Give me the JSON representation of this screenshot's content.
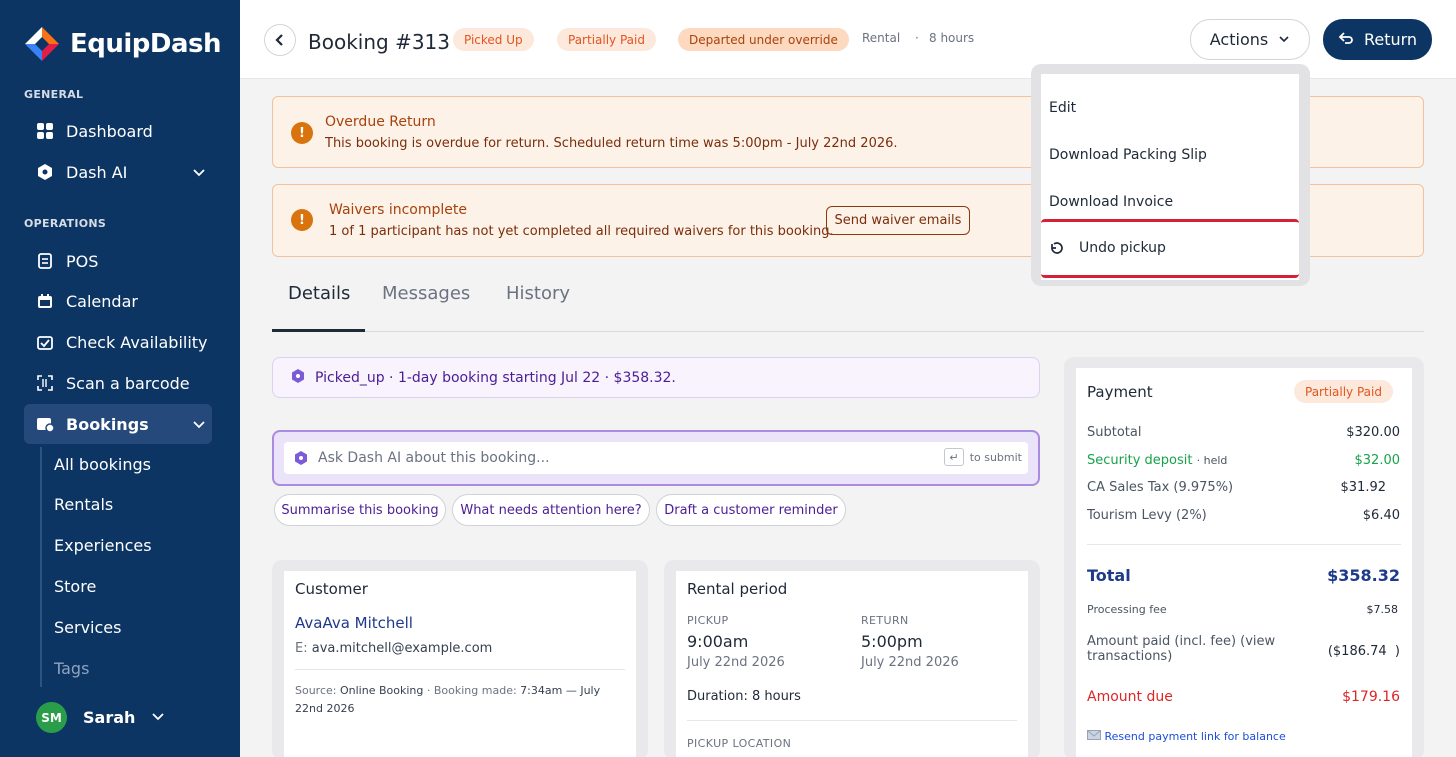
{
  "app": {
    "name": "EquipDash"
  },
  "sidebar": {
    "section_general": "GENERAL",
    "section_operations": "OPERATIONS",
    "items": {
      "dashboard": "Dashboard",
      "dash_ai": "Dash AI",
      "pos": "POS",
      "calendar": "Calendar",
      "check_availability": "Check Availability",
      "scan_barcode": "Scan a barcode",
      "bookings": "Bookings"
    },
    "bookings_sub": [
      "All bookings",
      "Rentals",
      "Experiences",
      "Store",
      "Services",
      "Tags"
    ],
    "user": {
      "initials": "SM",
      "name": "Sarah"
    }
  },
  "header": {
    "title": "Booking #313",
    "badges": [
      "Picked Up",
      "Partially Paid",
      "Departed under override"
    ],
    "type": "Rental",
    "sep": "·",
    "duration": "8 hours",
    "actions_label": "Actions",
    "return_label": "Return"
  },
  "actions_menu": {
    "items": [
      "Edit",
      "Download Packing Slip",
      "Download Invoice"
    ],
    "undo_label": "Undo pickup"
  },
  "alerts": {
    "overdue": {
      "title": "Overdue Return",
      "text": "This booking is overdue for return. Scheduled return time was 5:00pm - July 22nd 2026."
    },
    "waivers": {
      "title": "Waivers incomplete",
      "text": "1 of 1 participant has not yet completed all required waivers for this booking.",
      "button": "Send waiver emails"
    }
  },
  "tabs": [
    "Details",
    "Messages",
    "History"
  ],
  "summary": "Picked_up · 1-day booking starting Jul 22 · $358.32.",
  "ai": {
    "placeholder": "Ask Dash AI about this booking...",
    "enter_glyph": "↵",
    "submit_hint": "to submit",
    "suggestions": [
      "Summarise this booking",
      "What needs attention here?",
      "Draft a customer reminder"
    ]
  },
  "customer": {
    "title": "Customer",
    "name": "AvaAva Mitchell",
    "email_label": "E:",
    "email": "ava.mitchell@example.com",
    "source_label": "Source:",
    "source": "Online Booking",
    "made_label": "· Booking made:",
    "made_time": "7:34am — July",
    "made_date": "22nd 2026"
  },
  "rental_period": {
    "title": "Rental period",
    "pickup_label": "PICKUP",
    "pickup_time": "9:00am",
    "pickup_date": "July 22nd 2026",
    "return_label": "RETURN",
    "return_time": "5:00pm",
    "return_date": "July 22nd 2026",
    "duration": "Duration: 8 hours",
    "location_label": "PICKUP LOCATION"
  },
  "payment": {
    "title": "Payment",
    "badge": "Partially Paid",
    "rows": [
      {
        "label": "Subtotal",
        "value": "$320.00"
      },
      {
        "label": "Security deposit",
        "suffix": "· held",
        "value": "$32.00"
      },
      {
        "label": "CA Sales Tax (9.975%)",
        "value": "$31.92"
      },
      {
        "label": "Tourism Levy (2%)",
        "value": "$6.40"
      }
    ],
    "total_label": "Total",
    "total": "$358.32",
    "fee_label": "Processing fee",
    "fee": "$7.58",
    "paid_label_1": "Amount paid (incl. fee) (view",
    "paid_label_2": "transactions)",
    "paid": "($186.74  )",
    "due_label": "Amount due",
    "due": "$179.16",
    "resend": "Resend payment link for balance"
  },
  "colors": {
    "sidebar": "#0d3563",
    "accent_purple": "#7c5cd6",
    "alert_orange": "#d9730d",
    "danger": "#d3213a",
    "success": "#16a34a"
  }
}
